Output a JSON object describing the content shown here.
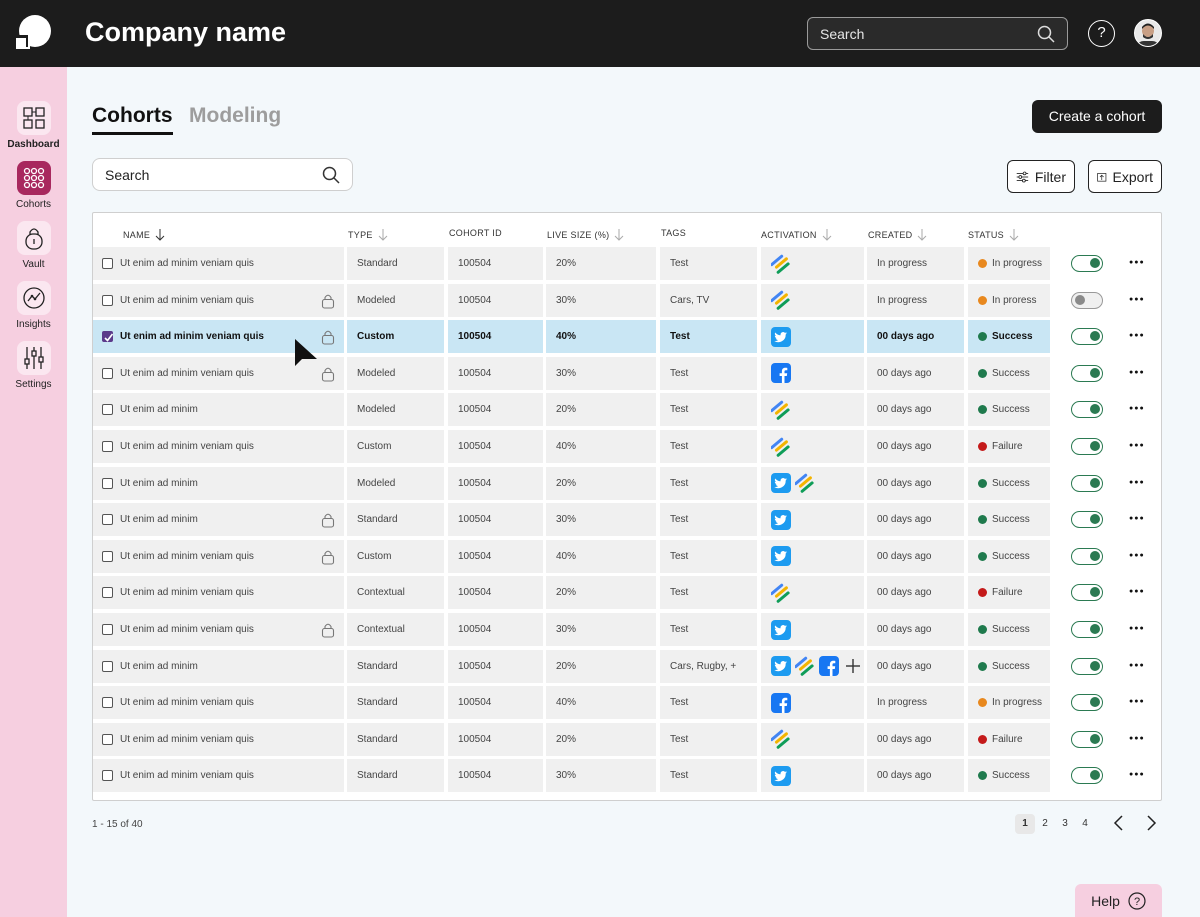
{
  "header": {
    "company": "Company name",
    "search_placeholder": "Search",
    "help_icon": "?"
  },
  "sidebar": {
    "items": [
      {
        "label": "Dashboard",
        "icon": "dashboard-icon"
      },
      {
        "label": "Cohorts",
        "icon": "cohorts-icon",
        "active": true
      },
      {
        "label": "Vault",
        "icon": "lock-icon"
      },
      {
        "label": "Insights",
        "icon": "insights-icon"
      },
      {
        "label": "Settings",
        "icon": "settings-icon"
      }
    ]
  },
  "tabs": {
    "active": "Cohorts",
    "inactive": "Modeling"
  },
  "create_label": "Create a cohort",
  "search_placeholder": "Search",
  "filter_label": "Filter",
  "export_label": "Export",
  "columns": [
    "NAME",
    "TYPE",
    "COHORT ID",
    "LIVE SIZE (%)",
    "TAGS",
    "ACTIVATION",
    "CREATED",
    "STATUS"
  ],
  "status_colors": {
    "In progress": "#e8881e",
    "In proress": "#e8881e",
    "Success": "#1f7a4d",
    "Failure": "#c41a1a"
  },
  "rows": [
    {
      "name": "Ut enim ad minim veniam quis",
      "lock": false,
      "type": "Standard",
      "id": "100504",
      "live": "20%",
      "tags": "Test",
      "activation": [
        "stripes"
      ],
      "created": "In progress",
      "status": "In progress",
      "toggle": true,
      "selected": false
    },
    {
      "name": "Ut enim ad minim veniam quis",
      "lock": true,
      "type": "Modeled",
      "id": "100504",
      "live": "30%",
      "tags": "Cars, TV",
      "activation": [
        "stripes"
      ],
      "created": "In progress",
      "status": "In proress",
      "toggle": false,
      "selected": false
    },
    {
      "name": "Ut enim ad minim veniam quis",
      "lock": true,
      "type": "Custom",
      "id": "100504",
      "live": "40%",
      "tags": "Test",
      "activation": [
        "twitter"
      ],
      "created": "00 days ago",
      "status": "Success",
      "toggle": true,
      "selected": true
    },
    {
      "name": "Ut enim ad minim veniam quis",
      "lock": true,
      "type": "Modeled",
      "id": "100504",
      "live": "30%",
      "tags": "Test",
      "activation": [
        "facebook"
      ],
      "created": "00 days ago",
      "status": "Success",
      "toggle": true,
      "selected": false
    },
    {
      "name": "Ut enim ad minim",
      "lock": false,
      "type": "Modeled",
      "id": "100504",
      "live": "20%",
      "tags": "Test",
      "activation": [
        "stripes"
      ],
      "created": "00 days ago",
      "status": "Success",
      "toggle": true,
      "selected": false
    },
    {
      "name": "Ut enim ad minim veniam quis",
      "lock": false,
      "type": "Custom",
      "id": "100504",
      "live": "40%",
      "tags": "Test",
      "activation": [
        "stripes"
      ],
      "created": "00 days ago",
      "status": "Failure",
      "toggle": true,
      "selected": false
    },
    {
      "name": "Ut enim ad minim",
      "lock": false,
      "type": "Modeled",
      "id": "100504",
      "live": "20%",
      "tags": "Test",
      "activation": [
        "twitter",
        "stripes"
      ],
      "created": "00 days ago",
      "status": "Success",
      "toggle": true,
      "selected": false
    },
    {
      "name": "Ut enim ad minim",
      "lock": true,
      "type": "Standard",
      "id": "100504",
      "live": "30%",
      "tags": "Test",
      "activation": [
        "twitter"
      ],
      "created": "00 days ago",
      "status": "Success",
      "toggle": true,
      "selected": false
    },
    {
      "name": "Ut enim ad minim veniam quis",
      "lock": true,
      "type": "Custom",
      "id": "100504",
      "live": "40%",
      "tags": "Test",
      "activation": [
        "twitter"
      ],
      "created": "00 days ago",
      "status": "Success",
      "toggle": true,
      "selected": false
    },
    {
      "name": "Ut enim ad minim veniam quis",
      "lock": false,
      "type": "Contextual",
      "id": "100504",
      "live": "20%",
      "tags": "Test",
      "activation": [
        "stripes"
      ],
      "created": "00 days ago",
      "status": "Failure",
      "toggle": true,
      "selected": false
    },
    {
      "name": "Ut enim ad minim veniam quis",
      "lock": true,
      "type": "Contextual",
      "id": "100504",
      "live": "30%",
      "tags": "Test",
      "activation": [
        "twitter"
      ],
      "created": "00 days ago",
      "status": "Success",
      "toggle": true,
      "selected": false
    },
    {
      "name": "Ut enim ad minim",
      "lock": false,
      "type": "Standard",
      "id": "100504",
      "live": "20%",
      "tags": "Cars, Rugby, +",
      "activation": [
        "twitter",
        "stripes",
        "facebook",
        "plus"
      ],
      "created": "00 days ago",
      "status": "Success",
      "toggle": true,
      "selected": false
    },
    {
      "name": "Ut enim ad minim veniam quis",
      "lock": false,
      "type": "Standard",
      "id": "100504",
      "live": "40%",
      "tags": "Test",
      "activation": [
        "facebook"
      ],
      "created": "In progress",
      "status": "In progress",
      "toggle": true,
      "selected": false
    },
    {
      "name": "Ut enim ad minim veniam quis",
      "lock": false,
      "type": "Standard",
      "id": "100504",
      "live": "20%",
      "tags": "Test",
      "activation": [
        "stripes"
      ],
      "created": "00 days ago",
      "status": "Failure",
      "toggle": true,
      "selected": false
    },
    {
      "name": "Ut enim ad minim veniam quis",
      "lock": false,
      "type": "Standard",
      "id": "100504",
      "live": "30%",
      "tags": "Test",
      "activation": [
        "twitter"
      ],
      "created": "00 days ago",
      "status": "Success",
      "toggle": true,
      "selected": false
    }
  ],
  "footer": {
    "count": "1 - 15 of 40",
    "pages": [
      "1",
      "2",
      "3",
      "4"
    ],
    "current_page": "1"
  },
  "help_label": "Help"
}
